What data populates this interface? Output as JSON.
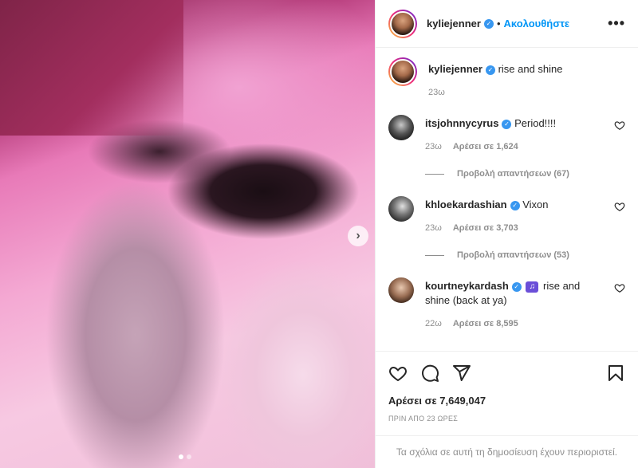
{
  "post": {
    "username": "kyliejenner",
    "follow_label": "Ακολουθήστε",
    "more_icon": "more-icon"
  },
  "caption": {
    "username": "kyliejenner",
    "text": "rise and shine",
    "time": "23ω"
  },
  "comments": [
    {
      "username": "itsjohnnycyrus",
      "text": "Period!!!!",
      "time": "23ω",
      "likes": "Αρέσει σε 1,624",
      "replies": "Προβολή απαντήσεων (67)",
      "avatar_color": "#2b2b2b"
    },
    {
      "username": "khloekardashian",
      "text": "Vixon",
      "time": "23ω",
      "likes": "Αρέσει σε 3,703",
      "replies": "Προβολή απαντήσεων (53)",
      "avatar_color": "#3a3a3a"
    },
    {
      "username": "kourtneykardash",
      "text": "rise and shine (back at ya)",
      "time": "22ω",
      "likes": "Αρέσει σε 8,595",
      "avatar_color": "#8a6a5a"
    }
  ],
  "footer": {
    "likes": "Αρέσει σε 7,649,047",
    "time_ago": "ΠΡΙΝ ΑΠΟ 23 ΩΡΕΣ",
    "restricted": "Τα σχόλια σε αυτή τη δημοσίευση έχουν περιοριστεί."
  },
  "colors": {
    "link": "#0095f6",
    "verified": "#3897f0",
    "muted": "#8e8e8e"
  }
}
